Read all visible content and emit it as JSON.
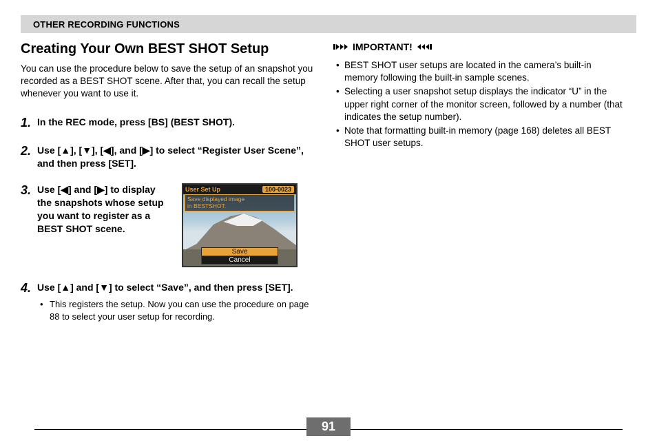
{
  "header": "OTHER RECORDING FUNCTIONS",
  "title": "Creating Your Own BEST SHOT Setup",
  "intro": "You can use the procedure below to save the setup of an snapshot you recorded as a BEST SHOT scene. After that, you can recall the setup whenever you want to use it.",
  "steps": [
    {
      "num": "1.",
      "text": "In the REC mode, press [BS] (BEST SHOT)."
    },
    {
      "num": "2.",
      "text": "Use [▲], [▼], [◀], and [▶] to select “Register User Scene”, and then press [SET]."
    },
    {
      "num": "3.",
      "text": "Use [◀] and [▶] to display the snapshots whose setup you want to register as a BEST SHOT scene."
    },
    {
      "num": "4.",
      "text": "Use [▲] and [▼] to select “Save”, and then press [SET].",
      "sub": "This registers the setup. Now you can use the procedure on page 88 to select your user setup for recording."
    }
  ],
  "thumb": {
    "title": "User Set Up",
    "counter": "100-0023",
    "msg1": "Save displayed image",
    "msg2": "in BESTSHOT.",
    "save": "Save",
    "cancel": "Cancel"
  },
  "important": {
    "label": "IMPORTANT!",
    "items": [
      "BEST SHOT user setups are located in the camera’s built-in memory following the built-in sample scenes.",
      "Selecting a user snapshot setup displays the indicator “U” in the upper right corner of the monitor screen, followed by a number (that indicates the setup number).",
      "Note that formatting built-in memory (page 168) deletes all BEST SHOT user setups."
    ]
  },
  "page_number": "91"
}
